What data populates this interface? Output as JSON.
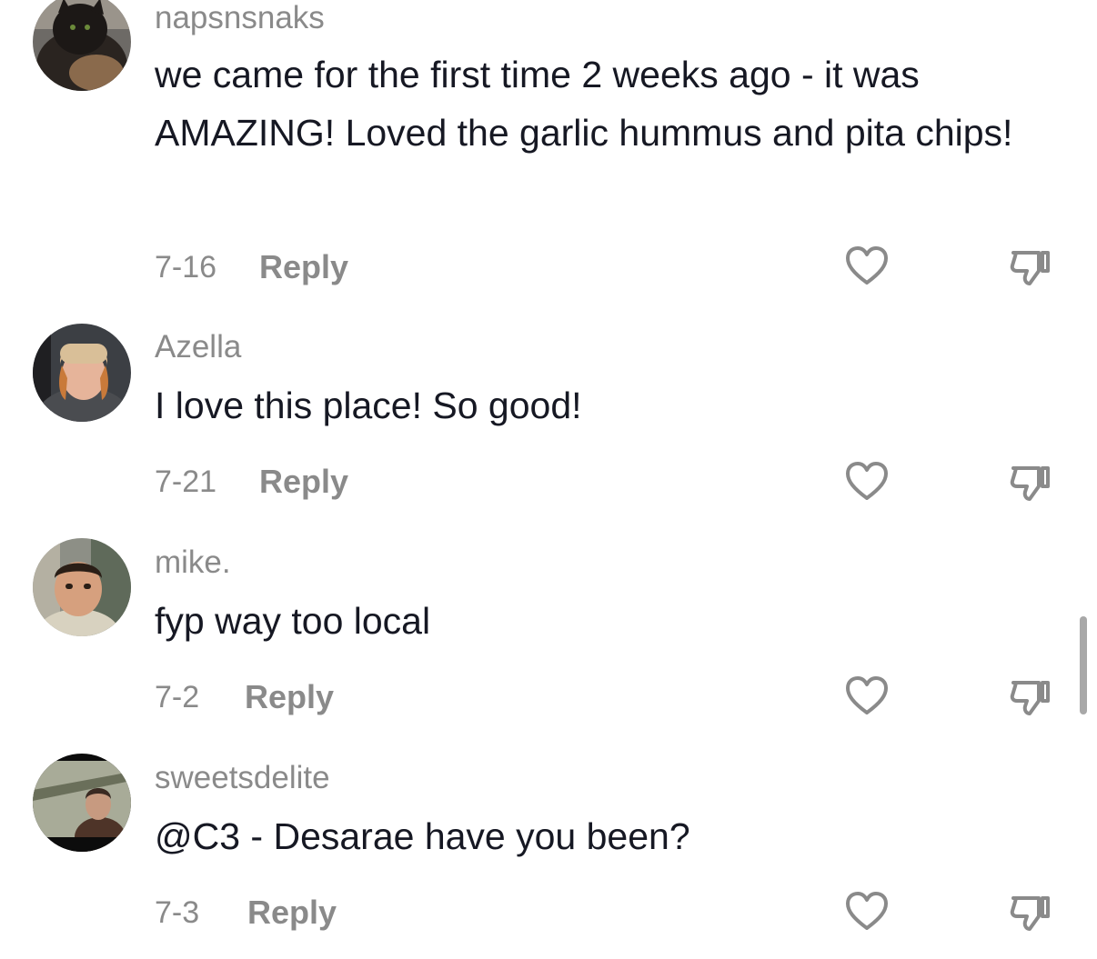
{
  "comments": [
    {
      "username": "napsnsnaks",
      "text": "we came for the first time 2 weeks ago - it was AMAZING! Loved the garlic hummus and pita chips!",
      "date": "7-16",
      "reply_label": "Reply",
      "avatar": "black-fluffy-cat-avatar"
    },
    {
      "username": "Azella",
      "text": "I love this place! So good!",
      "date": "7-21",
      "reply_label": "Reply",
      "avatar": "woman-beanie-avatar"
    },
    {
      "username": "mike.",
      "text": "fyp way too local",
      "date": "7-2",
      "reply_label": "Reply",
      "avatar": "man-outdoors-avatar"
    },
    {
      "username": "sweetsdelite",
      "text": "@C3 - Desarae have you been?",
      "date": "7-3",
      "reply_label": "Reply",
      "avatar": "woman-trees-avatar"
    }
  ],
  "icons": {
    "like": "heart-outline-icon",
    "dislike": "thumbs-down-icon"
  },
  "colors": {
    "text": "#161823",
    "secondary": "#8a8a8a",
    "scrollbar": "#a8a8a8"
  }
}
